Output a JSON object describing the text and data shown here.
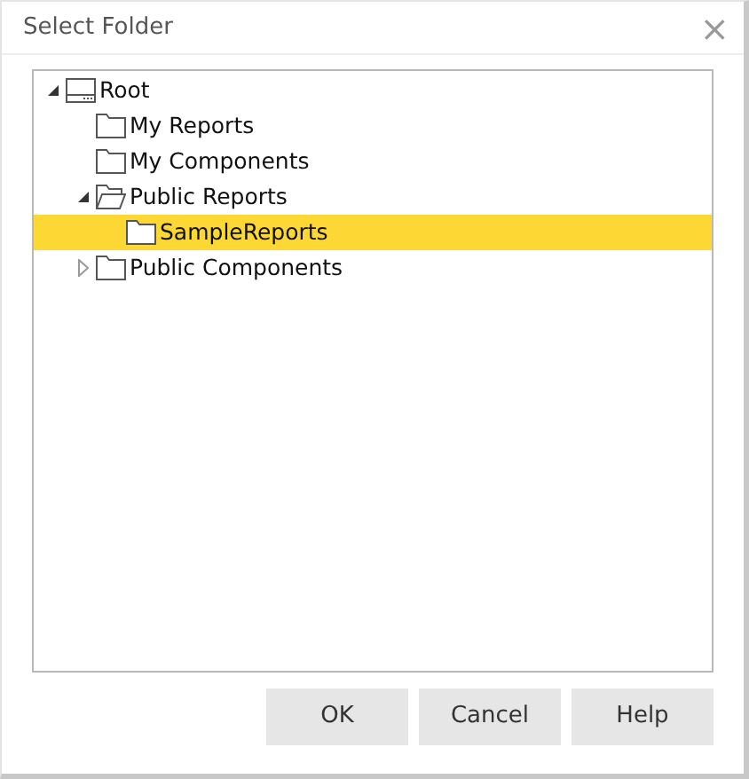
{
  "window": {
    "title": "Select Folder",
    "close": "×"
  },
  "tree": [
    {
      "label": "Root",
      "kind": "root",
      "expanded": true,
      "selected": false,
      "children": [
        {
          "label": "My Reports",
          "kind": "folder",
          "selected": false
        },
        {
          "label": "My Components",
          "kind": "folder",
          "selected": false
        },
        {
          "label": "Public Reports",
          "kind": "folder",
          "expanded": true,
          "selected": false,
          "children": [
            {
              "label": "SampleReports",
              "kind": "folder",
              "selected": true
            }
          ]
        },
        {
          "label": "Public Components",
          "kind": "folder",
          "expanded": false,
          "selected": false
        }
      ]
    }
  ],
  "buttons": [
    "OK",
    "Cancel",
    "Help"
  ]
}
